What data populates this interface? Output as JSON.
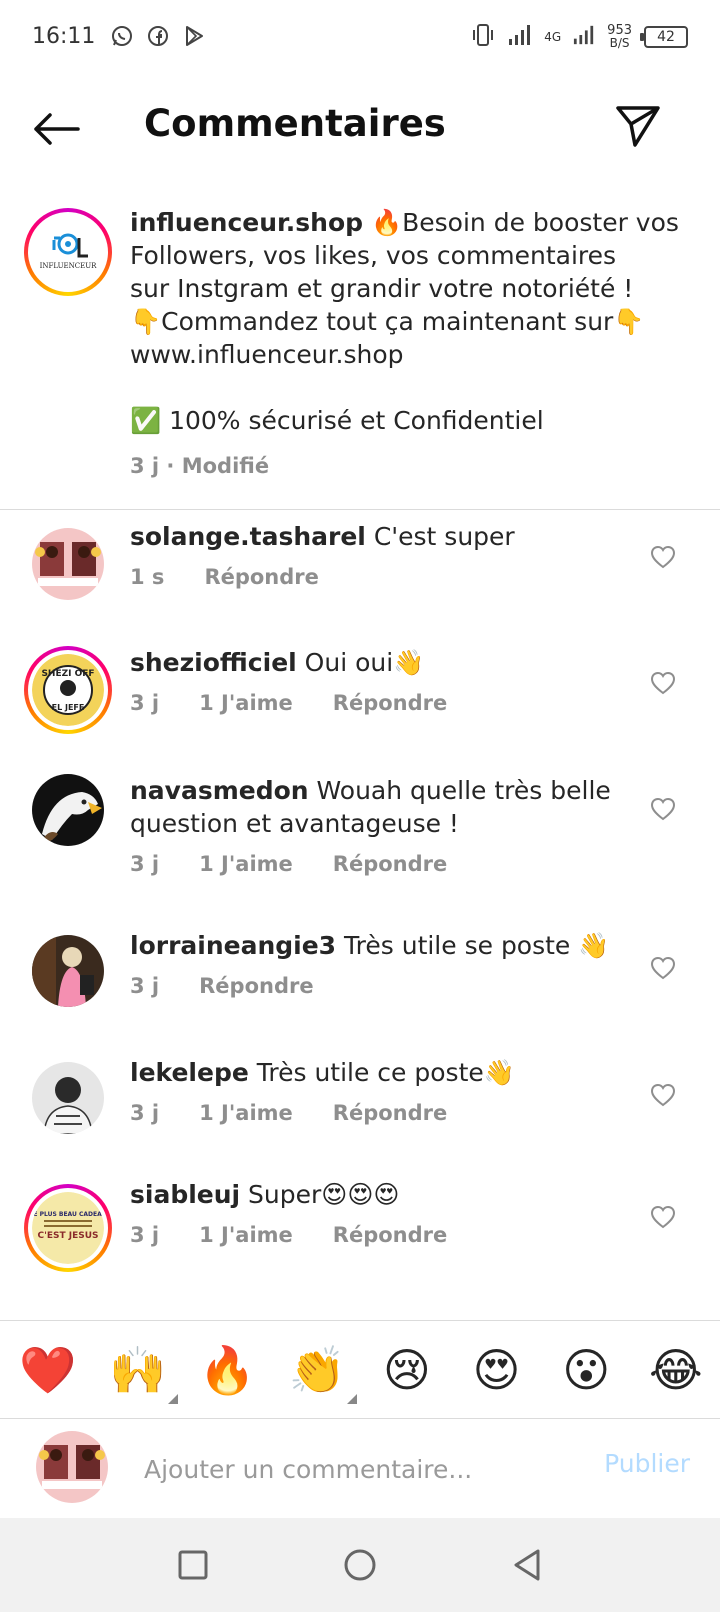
{
  "status_bar": {
    "time": "16:11",
    "network": "4G",
    "net_speed_value": "953",
    "net_speed_unit": "B/S",
    "battery": "42"
  },
  "header": {
    "title": "Commentaires"
  },
  "caption": {
    "username": "influenceur.shop",
    "lines": [
      " 🔥Besoin de booster vos",
      "Followers, vos likes, vos commentaires",
      "sur Instgram et grandir votre notoriété !",
      "👇Commandez tout ça maintenant sur👇",
      " www.influenceur.shop"
    ],
    "extra_line": "✅ 100% sécurisé et Confidentiel",
    "meta": "3 j · Modifié"
  },
  "comments": [
    {
      "username": "solange.tasharel",
      "text": " C'est super",
      "time": "1 s",
      "likes": "",
      "reply": "Répondre"
    },
    {
      "username": "sheziofficiel",
      "text": " Oui oui👋",
      "time": "3 j",
      "likes": "1 J'aime",
      "reply": "Répondre"
    },
    {
      "username": "navasmedon",
      "text": " Wouah quelle très belle question et avantageuse !",
      "time": "3 j",
      "likes": "1 J'aime",
      "reply": "Répondre"
    },
    {
      "username": "lorraineangie3",
      "text": " Très utile se poste 👋",
      "time": "3 j",
      "likes": "",
      "reply": "Répondre"
    },
    {
      "username": "lekelepe",
      "text": " Très utile ce poste👋",
      "time": "3 j",
      "likes": "1 J'aime",
      "reply": "Répondre"
    },
    {
      "username": "siableuj",
      "text": " Super😍😍😍",
      "time": "3 j",
      "likes": "1 J'aime",
      "reply": "Répondre"
    }
  ],
  "emoji_bar": [
    "❤️",
    "🙌",
    "🔥",
    "👏",
    "😢",
    "😍",
    "😮",
    "😂"
  ],
  "comment_input": {
    "placeholder": "Ajouter un commentaire...",
    "publish_label": "Publier"
  },
  "colors": {
    "publish": "#b3dbff",
    "meta_gray": "#8e8e8e",
    "divider": "#dbdbdb"
  }
}
